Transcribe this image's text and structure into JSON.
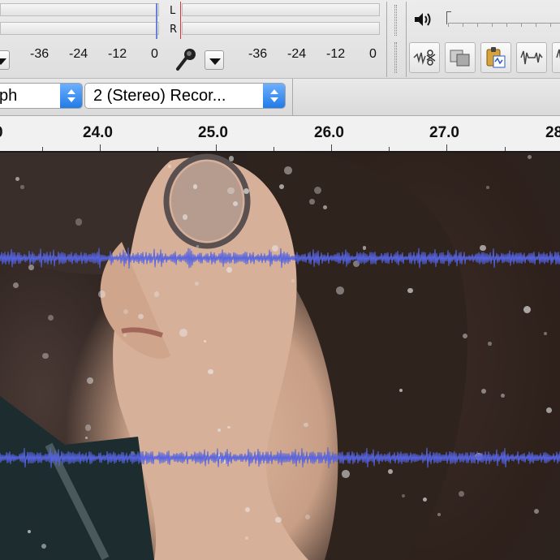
{
  "meters": {
    "left_channel": "L",
    "right_channel": "R",
    "playback_scale": [
      "-36",
      "-24",
      "-12",
      "0"
    ],
    "record_scale": [
      "-36",
      "-24",
      "-12",
      "0"
    ]
  },
  "devices": {
    "input_device_partial": "ph",
    "channels_select": "2 (Stereo) Recor..."
  },
  "timeline": {
    "partial_left": "0",
    "labels": [
      "24.0",
      "25.0",
      "26.0",
      "27.0"
    ],
    "partial_right": "28"
  },
  "colors": {
    "waveform": "#5563e0",
    "selection_line": "#d33333",
    "select_arrow": "#1f79e6"
  },
  "icons": {
    "mic": "microphone-icon",
    "speaker": "speaker-icon",
    "tools": [
      "trim-icon",
      "copy-icon",
      "paste-icon",
      "silence-icon",
      "waveform-icon"
    ]
  }
}
